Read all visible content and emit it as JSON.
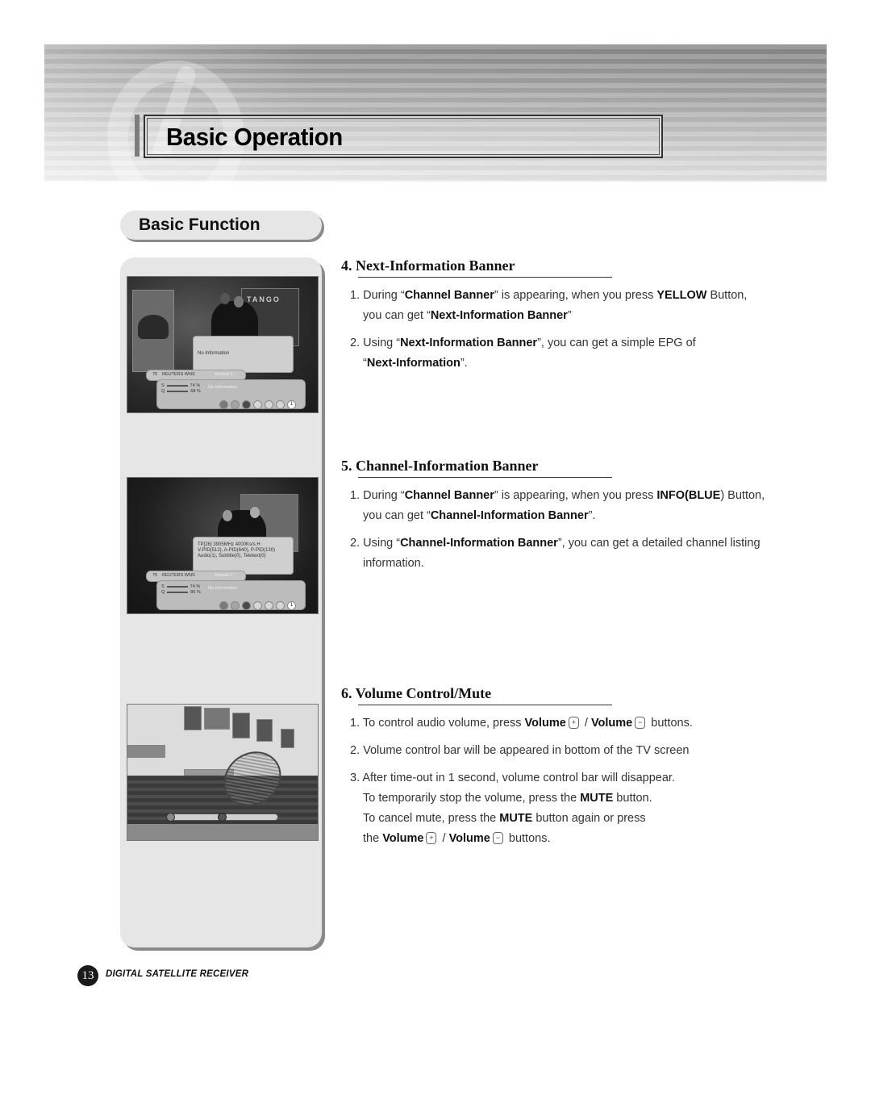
{
  "header": {
    "title": "Basic Operation"
  },
  "section_title": "Basic Function",
  "screens": {
    "next_info": {
      "poster_text": "TANGO",
      "info_text": "No Information",
      "channel_number": "75",
      "channel_name": "REUTERS WNS",
      "satellite": "Asiasat 2",
      "signal_s_label": "S",
      "signal_q_label": "Q",
      "signal_s": "74 %",
      "signal_q": "68 %",
      "epg_text": "No Information",
      "last_dot": "1"
    },
    "channel_info": {
      "info_lines": [
        "TP[26] 3905MHz 4000Ks/s H",
        "V-PID(512), A-PID(640), P-PID(130)",
        "Audio(1), Subtitle(0), Teletext(0)"
      ],
      "channel_number": "75",
      "channel_name": "REUTERS WNS",
      "satellite": "Asiasat 2",
      "signal_s_label": "S",
      "signal_q_label": "Q",
      "signal_s": "74 %",
      "signal_q": "86 %",
      "epg_text": "No Information",
      "last_dot": "1"
    },
    "volume": {
      "volume_level_percent": 50
    }
  },
  "sections": [
    {
      "heading": "4. Next-Information Banner",
      "items": [
        {
          "num": "1.",
          "p1": " During “",
          "b1": "Channel Banner",
          "p2": "” is appearing, when you press ",
          "b2": "YELLOW",
          "p3": " Button,",
          "c1": "you can get “",
          "cb1": "Next-Information Banner",
          "c2": "”"
        },
        {
          "num": "2.",
          "p1": " Using “",
          "b1": "Next-Information Banner",
          "p2": "”, you can get a simple EPG of",
          "c1": "“",
          "cb1": "Next-Information",
          "c2": "”."
        }
      ]
    },
    {
      "heading": "5. Channel-Information Banner",
      "items": [
        {
          "num": "1.",
          "p1": " During “",
          "b1": "Channel Banner",
          "p2": "” is appearing, when you press ",
          "b2": "INFO(BLUE",
          "p3": ") Button,",
          "c1": "you can get “",
          "cb1": "Channel-Information Banner",
          "c2": "”."
        },
        {
          "num": "2.",
          "p1": " Using “",
          "b1": "Channel-Information Banner",
          "p2": "”, you can get a detailed channel listing",
          "c1": "information."
        }
      ]
    },
    {
      "heading": "6. Volume Control/Mute",
      "items": [
        {
          "num": "1.",
          "p1": " To control audio volume, press ",
          "b1": "Volume",
          "sep": " / ",
          "b2": "Volume",
          "p3": " buttons."
        },
        {
          "num": "2.",
          "p1": " Volume control bar will be appeared in bottom of the TV screen"
        },
        {
          "num": "3.",
          "p1": " After time-out in 1 second, volume control bar will disappear.",
          "l2a": "To temporarily stop the volume, press the ",
          "l2b": "MUTE",
          "l2c": " button.",
          "l3a": "To cancel mute, press the ",
          "l3b": "MUTE",
          "l3c": " button again or press",
          "l4a": "the ",
          "l4b": "Volume",
          "l4sep": " / ",
          "l4d": "Volume",
          "l4e": " buttons."
        }
      ]
    }
  ],
  "icons": {
    "volume_up": "+",
    "volume_down": "−"
  },
  "footer": {
    "page_number": "13",
    "title": "DIGITAL SATELLITE RECEIVER"
  }
}
